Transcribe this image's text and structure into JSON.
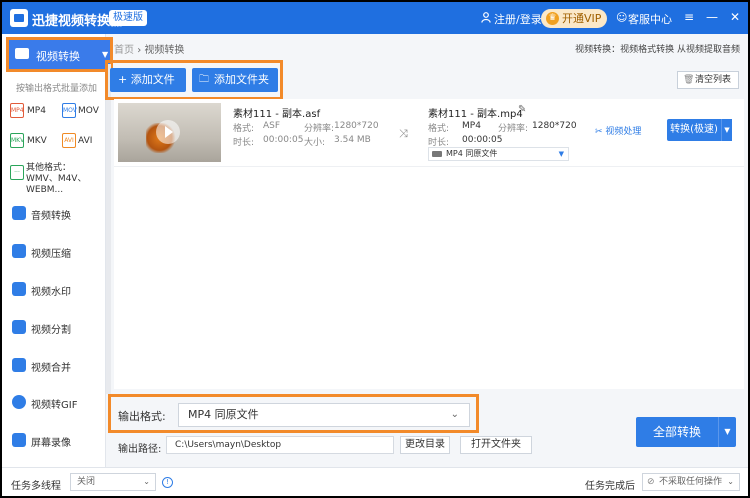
{
  "titlebar": {
    "app_title": "迅捷视频转换器",
    "edition": "极速版",
    "login": "注册/登录",
    "vip": "开通VIP",
    "service": "客服中心",
    "icons": {
      "logo": "app-logo",
      "user": "user-icon",
      "vip": "crown-icon",
      "service": "chat-icon",
      "menu": "menu-icon",
      "minimize": "minimize-icon",
      "close": "close-icon"
    }
  },
  "sidebar": {
    "active": {
      "label": "视频转换"
    },
    "batch_tip": "按输出格式批量添加",
    "formats": [
      "MP4",
      "MOV",
      "MKV",
      "AVI"
    ],
    "other_formats": "其他格式：WMV、M4V、WEBM...",
    "items": [
      {
        "label": "音频转换"
      },
      {
        "label": "视频压缩"
      },
      {
        "label": "视频水印"
      },
      {
        "label": "视频分割"
      },
      {
        "label": "视频合并"
      },
      {
        "label": "视频转GIF"
      },
      {
        "label": "屏幕录像"
      }
    ]
  },
  "header": {
    "breadcrumb_home": "首页",
    "breadcrumb_sep": "›",
    "breadcrumb_current": "视频转换",
    "subtitle": "视频转换：视频格式转换 从视频提取音频"
  },
  "toolbar": {
    "add_file": "+ 添加文件",
    "add_folder": "添加文件夹",
    "clear_list": "清空列表"
  },
  "file": {
    "source": {
      "name": "素材111 - 副本.asf",
      "format_label": "格式:",
      "format": "ASF",
      "resolution_label": "分辨率:",
      "resolution": "1280*720",
      "duration_label": "时长:",
      "duration": "00:00:05",
      "size_label": "大小:",
      "size": "3.54 MB"
    },
    "target": {
      "name": "素材111 - 副本.mp4",
      "format_label": "格式:",
      "format": "MP4",
      "resolution_label": "分辨率:",
      "resolution": "1280*720",
      "duration_label": "时长:",
      "duration": "00:00:05",
      "preset": "MP4   同原文件"
    },
    "process_link": "视频处理",
    "convert_button": "转换(极速)"
  },
  "output": {
    "format_label": "输出格式:",
    "format_value": "MP4   同原文件",
    "path_label": "输出路径:",
    "path_value": "C:\\Users\\mayn\\Desktop",
    "change_dir": "更改目录",
    "open_folder": "打开文件夹",
    "convert_all": "全部转换"
  },
  "statusbar": {
    "multithread_label": "任务多线程",
    "multithread_value": "关闭",
    "after_label": "任务完成后",
    "after_value": "不采取任何操作"
  },
  "colors": {
    "primary": "#2f7de6",
    "titlebar": "#1f6fe0",
    "highlight": "#f28a2a",
    "vip_bg": "#fbe8c8"
  }
}
